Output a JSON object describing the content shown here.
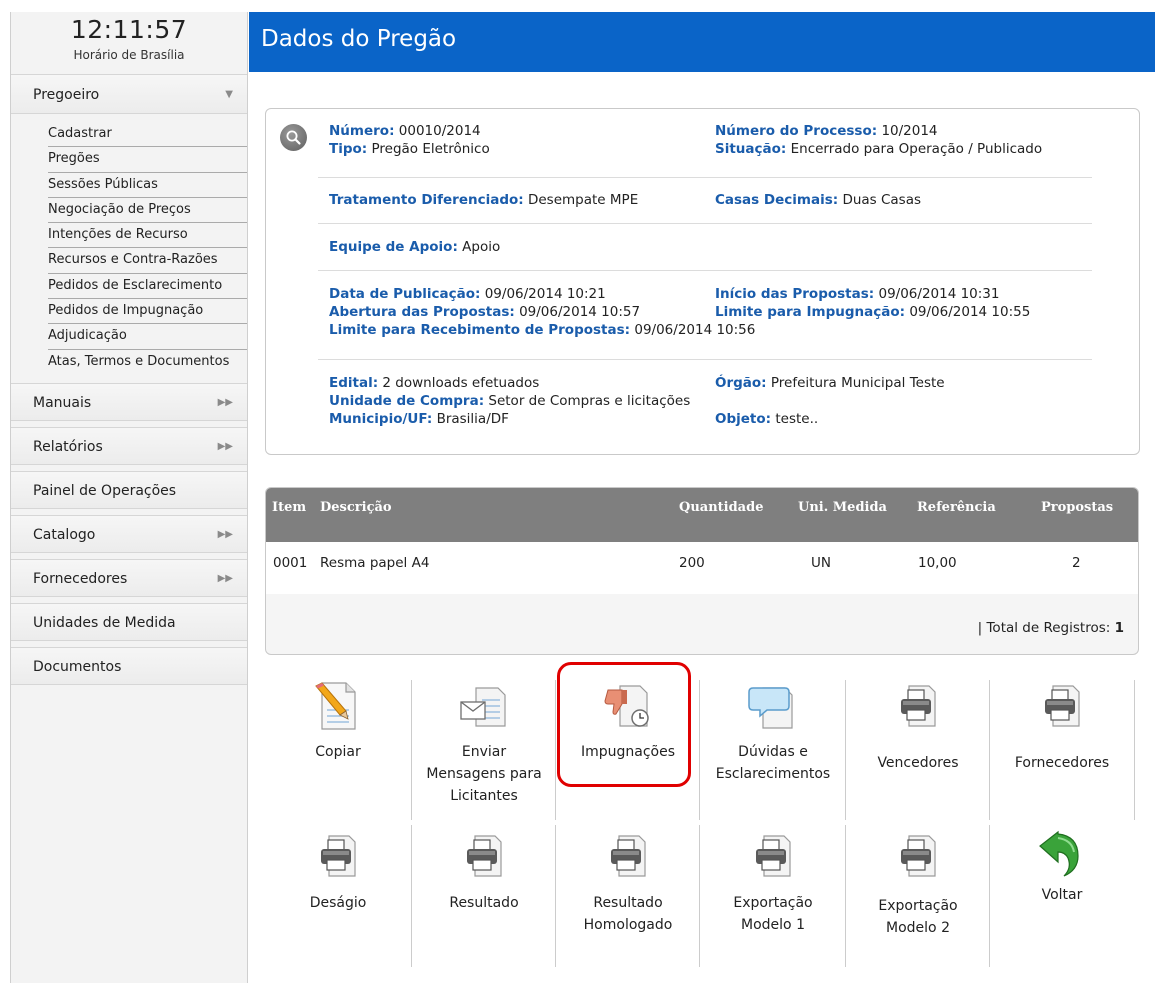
{
  "clock": {
    "time": "12:11:57",
    "subtitle": "Horário de Brasília"
  },
  "sidebar": {
    "pregoeiro": "Pregoeiro",
    "subitems": [
      "Cadastrar",
      "Pregões",
      "Sessões Públicas",
      "Negociação de Preços",
      "Intenções de Recurso",
      "Recursos e Contra-Razões",
      "Pedidos de Esclarecimento",
      "Pedidos de Impugnação",
      "Adjudicação",
      "Atas, Termos e Documentos"
    ],
    "menus": [
      "Manuais",
      "Relatórios",
      "Painel de Operações",
      "Catalogo",
      "Fornecedores",
      "Unidades de Medida",
      "Documentos"
    ]
  },
  "header": {
    "title": "Dados do Pregão"
  },
  "details": {
    "numero_label": "Número:",
    "numero": "00010/2014",
    "processo_label": "Número do Processo:",
    "processo": "10/2014",
    "tipo_label": "Tipo:",
    "tipo": "Pregão Eletrônico",
    "situacao_label": "Situação:",
    "situacao": "Encerrado para Operação / Publicado",
    "tratamento_label": "Tratamento Diferenciado:",
    "tratamento": "Desempate MPE",
    "casas_label": "Casas Decimais:",
    "casas": "Duas Casas",
    "equipe_label": "Equipe de Apoio:",
    "equipe": "Apoio",
    "publicacao_label": "Data de Publicação:",
    "publicacao": "09/06/2014 10:21",
    "inicio_label": "Início das Propostas:",
    "inicio": "09/06/2014 10:31",
    "abertura_label": "Abertura das Propostas:",
    "abertura": "09/06/2014 10:57",
    "limite_imp_label": "Limite para Impugnação:",
    "limite_imp": "09/06/2014 10:55",
    "limite_rec_label": "Limite para Recebimento de Propostas:",
    "limite_rec": "09/06/2014 10:56",
    "edital_label": "Edital:",
    "edital": "2 downloads efetuados",
    "orgao_label": "Órgão:",
    "orgao": "Prefeitura Municipal Teste",
    "unidade_label": "Unidade de Compra:",
    "unidade": "Setor de Compras e licitações",
    "municipio_label": "Municipio/UF:",
    "municipio": "Brasilia/DF",
    "objeto_label": "Objeto:",
    "objeto": "teste.."
  },
  "items_table": {
    "headers": [
      "Item",
      "Descrição",
      "Quantidade",
      "Uni. Medida",
      "Referência",
      "Propostas"
    ],
    "rows": [
      [
        "0001",
        "Resma papel A4",
        "200",
        "UN",
        "10,00",
        "2"
      ]
    ],
    "total_prefix": "| Total de Registros:",
    "total": "1"
  },
  "actions": {
    "copiar": "Copiar",
    "enviar_1": "Enviar",
    "enviar_2": "Mensagens para",
    "enviar_3": "Licitantes",
    "impugnacoes": "Impugnações",
    "duvidas_1": "Dúvidas e",
    "duvidas_2": "Esclarecimentos",
    "vencedores": "Vencedores",
    "fornecedores": "Fornecedores",
    "desagio": "Deságio",
    "resultado": "Resultado",
    "res_hom_1": "Resultado",
    "res_hom_2": "Homologado",
    "exp1_1": "Exportação",
    "exp1_2": "Modelo 1",
    "exp2_1": "Exportação",
    "exp2_2": "Modelo 2",
    "voltar": "Voltar"
  },
  "colors": {
    "header_blue": "#0a64c8",
    "label_blue": "#1a5cab",
    "table_head": "#7f7f7f",
    "highlight": "#e00000"
  }
}
